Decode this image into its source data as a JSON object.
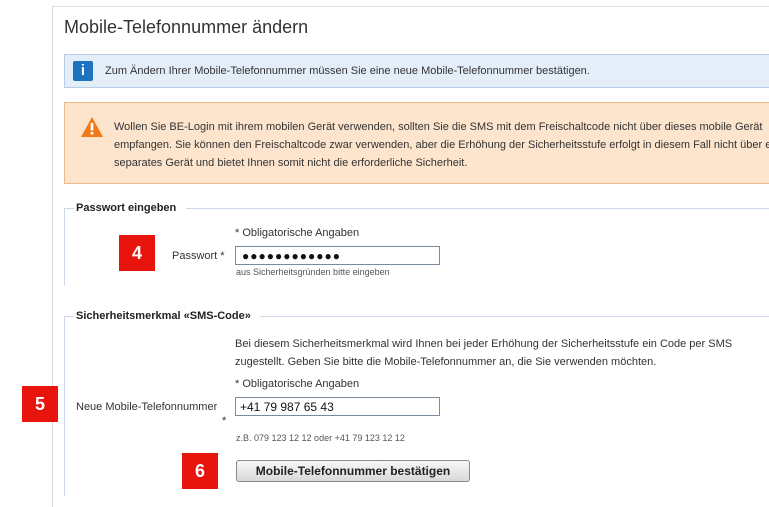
{
  "page": {
    "title": "Mobile-Telefonnummer ändern"
  },
  "info": {
    "icon": "info-icon",
    "icon_glyph": "i",
    "text": "Zum Ändern Ihrer Mobile-Telefonnummer müssen Sie eine neue Mobile-Telefonnummer bestätigen."
  },
  "warning": {
    "icon": "warning-icon",
    "color": "#f07a1a",
    "text": "Wollen Sie BE-Login mit ihrem mobilen Gerät verwenden, sollten Sie die SMS mit dem Freischaltcode nicht über dieses mobile Gerät empfangen. Sie können den Freischaltcode zwar verwenden, aber die Erhöhung der Sicherheitsstufe erfolgt in diesem Fall nicht über ein separates Gerät und bietet Ihnen somit nicht die erforderliche Sicherheit."
  },
  "password_section": {
    "title": "Passwort eingeben",
    "required_note": "* Obligatorische Angaben",
    "label": "Passwort *",
    "value_masked": "●●●●●●●●●●●●",
    "hint": "aus Sicherheitsgründen bitte eingeben",
    "badge": "4"
  },
  "sms_section": {
    "title": "Sicherheitsmerkmal «SMS-Code»",
    "description_line1": "Bei diesem Sicherheitsmerkmal wird Ihnen bei jeder Erhöhung der Sicherheitsstufe ein Code per SMS",
    "description_line2": "zugestellt. Geben Sie bitte die Mobile-Telefonnummer an, die Sie verwenden möchten.",
    "required_note": "* Obligatorische Angaben",
    "label": "Neue Mobile-Telefonnummer",
    "label_star": "*",
    "phone_value": "+41 79 987 65 43",
    "example": "z.B. 079 123 12 12 oder +41 79 123 12 12",
    "badge_phone": "5",
    "badge_button": "6",
    "confirm_button": "Mobile-Telefonnummer bestätigen"
  },
  "colors": {
    "badge": "#e8150f",
    "info_bg": "#e4eef9",
    "info_icon": "#1e73be",
    "warning_bg": "#fde4cd"
  }
}
